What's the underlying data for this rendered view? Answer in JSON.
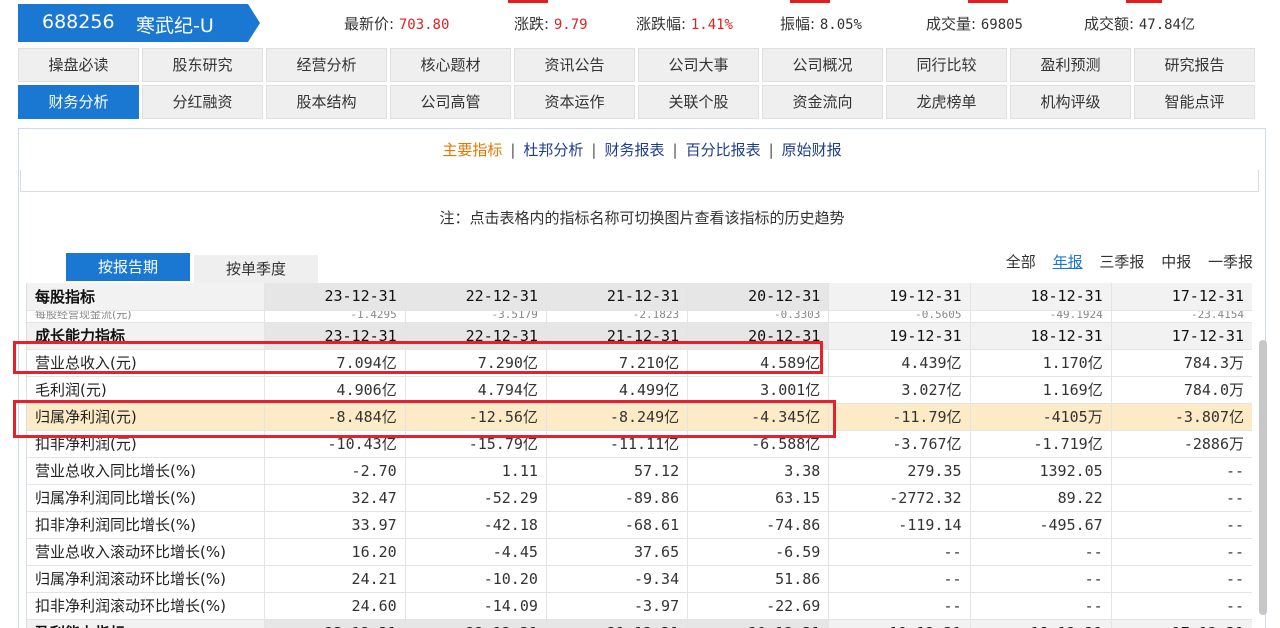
{
  "quote": {
    "code": "688256",
    "name": "寒武纪-U",
    "price_label": "最新价:",
    "price": "703.80",
    "change_label": "涨跌:",
    "change": "9.79",
    "pct_label": "涨跌幅:",
    "pct": "1.41%",
    "amp_label": "振幅:",
    "amp": "8.05%",
    "vol_label": "成交量:",
    "vol": "69805",
    "amt_label": "成交额:",
    "amt": "47.84亿"
  },
  "nav": {
    "row1": [
      "操盘必读",
      "股东研究",
      "经营分析",
      "核心题材",
      "资讯公告",
      "公司大事",
      "公司概况",
      "同行比较",
      "盈利预测",
      "研究报告"
    ],
    "row2": [
      "财务分析",
      "分红融资",
      "股本结构",
      "公司高管",
      "资本运作",
      "关联个股",
      "资金流向",
      "龙虎榜单",
      "机构评级",
      "智能点评"
    ]
  },
  "subnav": [
    "主要指标",
    "杜邦分析",
    "财务报表",
    "百分比报表",
    "原始财报"
  ],
  "note": "注：点击表格内的指标名称可切换图片查看该指标的历史趋势",
  "period_tabs": [
    "按报告期",
    "按单季度"
  ],
  "freq": [
    "全部",
    "年报",
    "三季报",
    "中报",
    "一季报"
  ],
  "table": {
    "section1_title": "每股指标",
    "section2_title": "成长能力指标",
    "section3_title": "盈利能力指标",
    "periods": [
      "23-12-31",
      "22-12-31",
      "21-12-31",
      "20-12-31",
      "19-12-31",
      "18-12-31",
      "17-12-31"
    ],
    "ghost_row": {
      "label": "每股经营现金流(元)",
      "values": [
        "-1.4295",
        "-3.5179",
        "-2.1823",
        "-0.3303",
        "-0.5605",
        "-49.1924",
        "-23.4154"
      ]
    },
    "rows": [
      {
        "label": "营业总收入(元)",
        "values": [
          "7.094亿",
          "7.290亿",
          "7.210亿",
          "4.589亿",
          "4.439亿",
          "1.170亿",
          "784.3万"
        ]
      },
      {
        "label": "毛利润(元)",
        "values": [
          "4.906亿",
          "4.794亿",
          "4.499亿",
          "3.001亿",
          "3.027亿",
          "1.169亿",
          "784.0万"
        ]
      },
      {
        "label": "归属净利润(元)",
        "values": [
          "-8.484亿",
          "-12.56亿",
          "-8.249亿",
          "-4.345亿",
          "-11.79亿",
          "-4105万",
          "-3.807亿"
        ]
      },
      {
        "label": "扣非净利润(元)",
        "values": [
          "-10.43亿",
          "-15.79亿",
          "-11.11亿",
          "-6.588亿",
          "-3.767亿",
          "-1.719亿",
          "-2886万"
        ]
      },
      {
        "label": "营业总收入同比增长(%)",
        "values": [
          "-2.70",
          "1.11",
          "57.12",
          "3.38",
          "279.35",
          "1392.05",
          "--"
        ]
      },
      {
        "label": "归属净利润同比增长(%)",
        "values": [
          "32.47",
          "-52.29",
          "-89.86",
          "63.15",
          "-2772.32",
          "89.22",
          "--"
        ]
      },
      {
        "label": "扣非净利润同比增长(%)",
        "values": [
          "33.97",
          "-42.18",
          "-68.61",
          "-74.86",
          "-119.14",
          "-495.67",
          "--"
        ]
      },
      {
        "label": "营业总收入滚动环比增长(%)",
        "values": [
          "16.20",
          "-4.45",
          "37.65",
          "-6.59",
          "--",
          "--",
          "--"
        ]
      },
      {
        "label": "归属净利润滚动环比增长(%)",
        "values": [
          "24.21",
          "-10.20",
          "-9.34",
          "51.86",
          "--",
          "--",
          "--"
        ]
      },
      {
        "label": "扣非净利润滚动环比增长(%)",
        "values": [
          "24.60",
          "-14.09",
          "-3.97",
          "-22.69",
          "--",
          "--",
          "--"
        ]
      }
    ]
  },
  "colors": {
    "accent": "#1a78d2",
    "red": "#e02020",
    "highlight_row": "#fdebc7",
    "annotation": "#e8202a"
  }
}
